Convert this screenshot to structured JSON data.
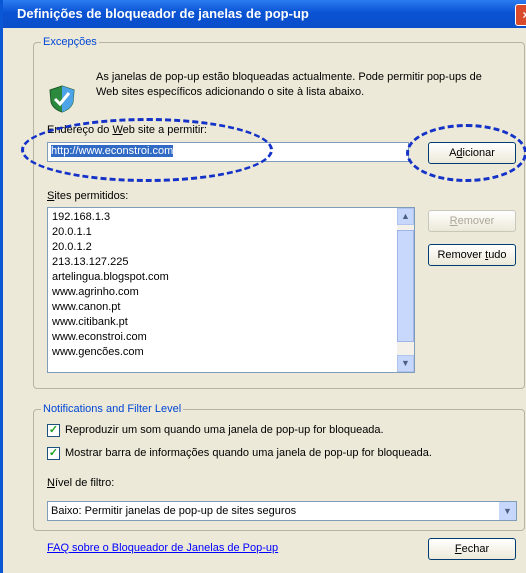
{
  "window": {
    "title": "Definições de bloqueador de janelas de pop-up",
    "close_glyph": "×"
  },
  "exceptions": {
    "legend": "Excepções",
    "info": "As janelas de pop-up estão bloqueadas actualmente. Pode permitir pop-ups de Web sites específicos adicionando o site à lista abaixo.",
    "icon": "shield-check-icon",
    "address_label_before": "Endereço do ",
    "address_label_underlined": "W",
    "address_label_after": "eb site a permitir:",
    "address_value": "http://www.econstroi.com",
    "add_button_before": "A",
    "add_button_underlined": "d",
    "add_button_after": "icionar",
    "allowed_label_underlined": "S",
    "allowed_label_after": "ites permitidos:",
    "allowed_sites": [
      "192.168.1.3",
      "20.0.1.1",
      "20.0.1.2",
      "213.13.127.225",
      "artelingua.blogspot.com",
      "www.agrinho.com",
      "www.canon.pt",
      "www.citibank.pt",
      "www.econstroi.com",
      "www.gencões.com"
    ],
    "remove_button_underlined": "R",
    "remove_button_after": "emover",
    "remove_all_button_before": "Remover ",
    "remove_all_button_underlined": "t",
    "remove_all_button_after": "udo"
  },
  "notifications": {
    "legend": "Notifications and Filter Level",
    "play_sound": {
      "checked": true,
      "label": "Reproduzir um som quando uma janela de pop-up for bloqueada."
    },
    "show_bar": {
      "checked": true,
      "label": "Mostrar barra de informações quando uma janela de pop-up for bloqueada."
    },
    "filter_label_underlined": "N",
    "filter_label_after": "ível de filtro:",
    "filter_value": "Baixo: Permitir janelas de pop-up de sites seguros"
  },
  "footer": {
    "faq_link": "FAQ sobre o Bloqueador de Janelas de Pop-up",
    "close_button_underlined": "F",
    "close_button_after": "echar"
  },
  "colors": {
    "title_bar": "#0a53d4",
    "legend_text": "#0046d5",
    "annotation": "#1432c8",
    "link": "#0000ff"
  }
}
